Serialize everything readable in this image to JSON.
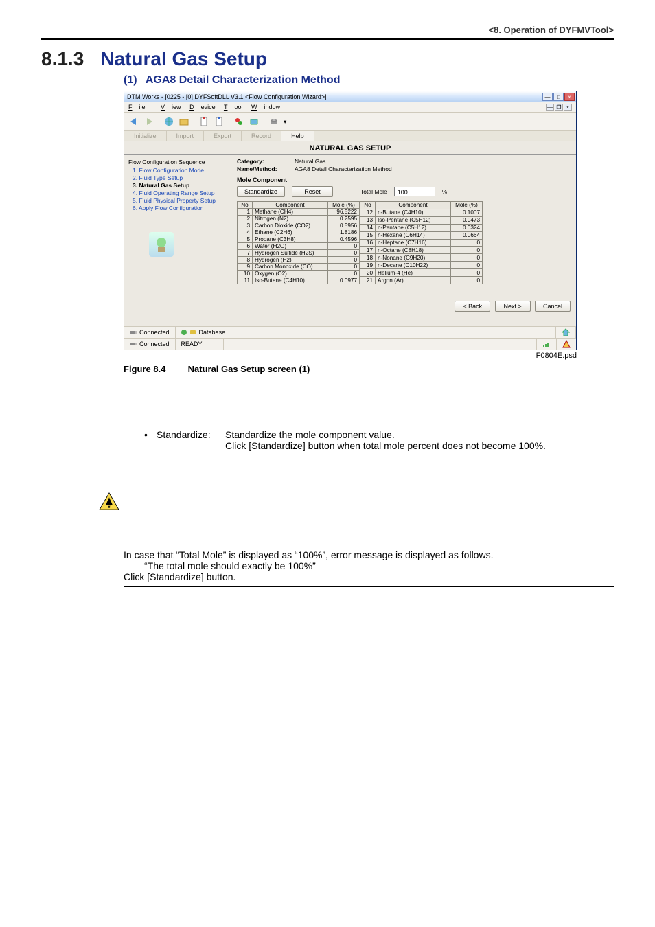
{
  "header": {
    "chapter_ref": "<8.  Operation of DYFMVTool>"
  },
  "heading": {
    "num": "8.1.3",
    "title": "Natural Gas Setup"
  },
  "subheading": {
    "num": "(1)",
    "title": "AGA8 Detail Characterization Method"
  },
  "app": {
    "title": "DTM Works - [0225 - [0] DYFSoftDLL V3.1 <Flow Configuration Wizard>]",
    "titlebar_close": "×",
    "titlebar_max": "□",
    "titlebar_min": "—",
    "mdi_min": "—",
    "mdi_restore": "❐",
    "mdi_close": "×",
    "menu": {
      "file": "File",
      "view": "View",
      "device": "Device",
      "tool": "Tool",
      "window": "Window"
    },
    "tabs": {
      "initialize": "Initialize",
      "import": "Import",
      "export": "Export",
      "record": "Record",
      "help": "Help"
    },
    "panel_title": "NATURAL GAS SETUP",
    "sidebar": {
      "heading": "Flow Configuration Sequence",
      "items": [
        "1. Flow Configuration Mode",
        "2. Fluid Type Setup",
        "3. Natural Gas Setup",
        "4. Fluid Operating Range Setup",
        "5. Fluid Physical Property Setup",
        "6. Apply Flow Configuration"
      ],
      "active_index": 2
    },
    "kv_category_label": "Category:",
    "kv_category_value": "Natural Gas",
    "kv_namemethod_label": "Name/Method:",
    "kv_namemethod_value": "AGA8 Detail Characterization Method",
    "section_label": "Mole Component",
    "standardize_btn": "Standardize",
    "reset_btn": "Reset",
    "total_mole_label": "Total Mole",
    "total_mole_value": "100",
    "total_mole_unit": "%",
    "table": {
      "col_no": "No",
      "col_component": "Component",
      "col_mole": "Mole (%)"
    },
    "components_left": [
      {
        "no": "1",
        "name": "Methane (CH4)",
        "mole": "96.5222"
      },
      {
        "no": "2",
        "name": "Nitrogen (N2)",
        "mole": "0.2595"
      },
      {
        "no": "3",
        "name": "Carbon Dioxide (CO2)",
        "mole": "0.5956"
      },
      {
        "no": "4",
        "name": "Ethane (C2H6)",
        "mole": "1.8186"
      },
      {
        "no": "5",
        "name": "Propane (C3H8)",
        "mole": "0.4596"
      },
      {
        "no": "6",
        "name": "Water (H2O)",
        "mole": "0"
      },
      {
        "no": "7",
        "name": "Hydrogen Sulfide (H2S)",
        "mole": "0"
      },
      {
        "no": "8",
        "name": "Hydrogen (H2)",
        "mole": "0"
      },
      {
        "no": "9",
        "name": "Carbon Monoxide (CO)",
        "mole": "0"
      },
      {
        "no": "10",
        "name": "Oxygen (O2)",
        "mole": "0"
      },
      {
        "no": "11",
        "name": "Iso-Butane (C4H10)",
        "mole": "0.0977"
      }
    ],
    "components_right": [
      {
        "no": "12",
        "name": "n-Butane (C4H10)",
        "mole": "0.1007"
      },
      {
        "no": "13",
        "name": "Iso-Pentane (C5H12)",
        "mole": "0.0473"
      },
      {
        "no": "14",
        "name": "n-Pentane (C5H12)",
        "mole": "0.0324"
      },
      {
        "no": "15",
        "name": "n-Hexane (C6H14)",
        "mole": "0.0664"
      },
      {
        "no": "16",
        "name": "n-Heptane (C7H16)",
        "mole": "0"
      },
      {
        "no": "17",
        "name": "n-Octane (C8H18)",
        "mole": "0"
      },
      {
        "no": "18",
        "name": "n-Nonane (C9H20)",
        "mole": "0"
      },
      {
        "no": "19",
        "name": "n-Decane (C10H22)",
        "mole": "0"
      },
      {
        "no": "20",
        "name": "Helium-4 (He)",
        "mole": "0"
      },
      {
        "no": "21",
        "name": "Argon (Ar)",
        "mole": "0"
      }
    ],
    "back_btn": "< Back",
    "next_btn": "Next >",
    "cancel_btn": "Cancel",
    "status_connected": "Connected",
    "status_database": "Database",
    "status_bottom_connected": "Connected",
    "status_ready": "READY"
  },
  "figure": {
    "id": "F0804E.psd",
    "num": "Figure 8.4",
    "caption": "Natural Gas Setup screen (1)"
  },
  "body": {
    "term": "Standardize:",
    "line1": "Standardize the mole component value.",
    "line2": "Click [Standardize] button when total mole percent does not become 100%."
  },
  "caution": {
    "line1": "In case that “Total Mole” is displayed as “100%”, error message is displayed as follows.",
    "line2": "“The total mole should exactly be 100%”",
    "line3": "Click [Standardize] button."
  }
}
